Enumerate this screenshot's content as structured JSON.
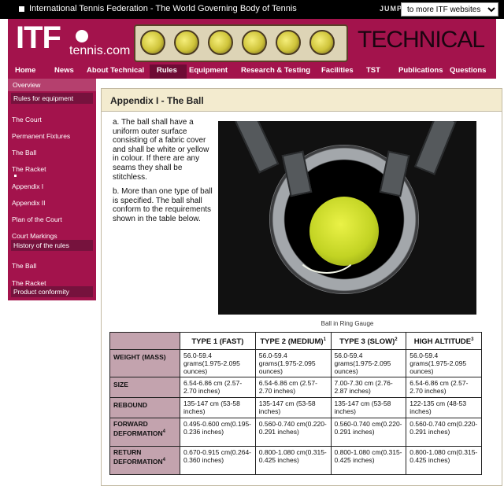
{
  "topbar": {
    "title": "International Tennis Federation - The World Governing Body of Tennis",
    "jump_label": "JUMP",
    "jump_select": "to more ITF websites"
  },
  "banner": {
    "logo_text": "ITF",
    "site_name": "tennis.com",
    "section_title": "TECHNICAL",
    "accent_color": "#a3134c"
  },
  "nav": {
    "items": [
      "Home",
      "News",
      "About Technical",
      "Rules",
      "Equipment",
      "Research & Testing",
      "Facilities",
      "TST",
      "Publications",
      "Questions"
    ],
    "active": "Rules"
  },
  "sidebar": {
    "overview": "Overview",
    "header1": "Rules for equipment",
    "items1": [
      "The Court",
      "Permanent Fixtures",
      "The Ball",
      "The Racket",
      "Appendix I",
      "Appendix II",
      "Plan of the Court",
      "Court Markings"
    ],
    "header2": "History of the rules",
    "items2": [
      "The Ball",
      "The Racket"
    ],
    "header3": "Product conformity"
  },
  "content": {
    "heading": "Appendix I - The Ball",
    "para_a": "a. The ball shall have a uniform outer surface consisting of a fabric cover and shall be white or yellow in colour. If there are any seams they shall be stitchless.",
    "para_b": "b. More than one type of ball is specified. The ball shall conform to the requirements shown in the table below.",
    "photo_caption": "Ball in Ring Gauge"
  },
  "table": {
    "headers": [
      {
        "label": "TYPE 1 (FAST)",
        "sup": ""
      },
      {
        "label": "TYPE 2 (MEDIUM)",
        "sup": "1"
      },
      {
        "label": "TYPE 3 (SLOW)",
        "sup": "2"
      },
      {
        "label": "HIGH ALTITUDE",
        "sup": "3"
      }
    ],
    "rows": [
      {
        "label": "WEIGHT (MASS)",
        "sup": "",
        "cells": [
          "56.0-59.4 grams(1.975-2.095 ounces)",
          "56.0-59.4 grams(1.975-2.095 ounces)",
          "56.0-59.4 grams(1.975-2.095 ounces)",
          "56.0-59.4 grams(1.975-2.095 ounces)"
        ]
      },
      {
        "label": "SIZE",
        "sup": "",
        "cells": [
          "6.54-6.86 cm (2.57-2.70 inches)",
          "6.54-6.86 cm (2.57-2.70 inches)",
          "7.00-7.30 cm (2.76-2.87 inches)",
          "6.54-6.86 cm (2.57-2.70 inches)"
        ]
      },
      {
        "label": "REBOUND",
        "sup": "",
        "cells": [
          "135-147 cm (53-58 inches)",
          "135-147 cm (53-58 inches)",
          "135-147 cm (53-58 inches)",
          "122-135 cm (48-53 inches)"
        ]
      },
      {
        "label": "FORWARD DEFORMATION",
        "sup": "4",
        "cells": [
          "0.495-0.600 cm(0.195-0.236 inches)",
          "0.560-0.740 cm(0.220-0.291 inches)",
          "0.560-0.740 cm(0.220-0.291 inches)",
          "0.560-0.740 cm(0.220-0.291 inches)"
        ]
      },
      {
        "label": "RETURN DEFORMATION",
        "sup": "4",
        "cells": [
          "0.670-0.915 cm(0.264-0.360 inches)",
          "0.800-1.080 cm(0.315-0.425 inches)",
          "0.800-1.080 cm(0.315-0.425 inches)",
          "0.800-1.080 cm(0.315-0.425 inches)"
        ]
      }
    ]
  }
}
